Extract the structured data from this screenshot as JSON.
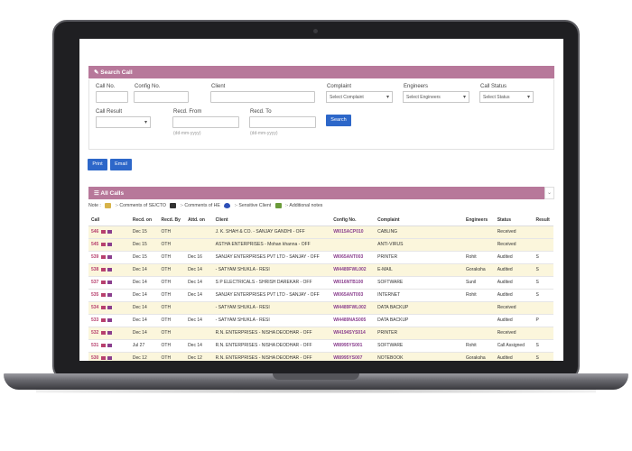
{
  "search": {
    "title": "Search Call",
    "call_no_label": "Call No.",
    "config_no_label": "Config No.",
    "client_label": "Client",
    "complaint_label": "Complaint",
    "complaint_value": "Select Complaint",
    "engineers_label": "Engineers",
    "engineers_value": "Select Engineers",
    "call_status_label": "Call Status",
    "call_status_value": "Select Status",
    "call_result_label": "Call Result",
    "recd_from_label": "Recd. From",
    "recd_to_label": "Recd. To",
    "date_hint_from": "(dd-mm-yyyy)",
    "date_hint_to": "(dd-mm-yyyy)",
    "search_button": "Search"
  },
  "actions": {
    "print": "Print",
    "email": "Email"
  },
  "all_calls": {
    "title": "All Calls",
    "note_label": "Note :",
    "note_se": ":- Comments of SE/CTO",
    "note_he": ":- Comments of HE",
    "note_sensitive": ":- Sensitive Client",
    "note_additional": ":- Additional notes",
    "columns": [
      "Call",
      "Recd. on",
      "Recd. By",
      "Attd. on",
      "Client",
      "Config No.",
      "Complaint",
      "Engineers",
      "Status",
      "Result"
    ],
    "rows": [
      {
        "call": "546",
        "recd_on": "Dec 15",
        "recd_by": "OTH",
        "attd_on": "",
        "client": "J. K. SHAH & CO. - SANJAY GANDHI - OFF",
        "config": "WI015ACP010",
        "complaint": "CABLING",
        "engineer": "",
        "status": "Received",
        "result": ""
      },
      {
        "call": "545",
        "recd_on": "Dec 15",
        "recd_by": "OTH",
        "attd_on": "",
        "client": "ASTHA ENTERPRISES - Mohan khanna - OFF",
        "config": "",
        "complaint": "ANTI-VIRUS",
        "engineer": "",
        "status": "Received",
        "result": ""
      },
      {
        "call": "539",
        "recd_on": "Dec 15",
        "recd_by": "OTH",
        "attd_on": "Dec 16",
        "client": "SANJAY ENTERPRISES PVT LTD - SANJAY - OFF",
        "config": "WI065ANT003",
        "complaint": "PRINTER",
        "engineer": "Rohit",
        "status": "Audited",
        "result": "S"
      },
      {
        "call": "538",
        "recd_on": "Dec 14",
        "recd_by": "OTH",
        "attd_on": "Dec 14",
        "client": "- SATYAM SHUKLA - RESI",
        "config": "WI4489FWL002",
        "complaint": "E-MAIL",
        "engineer": "Goraksha",
        "status": "Audited",
        "result": "S"
      },
      {
        "call": "537",
        "recd_on": "Dec 14",
        "recd_by": "OTH",
        "attd_on": "Dec 14",
        "client": "S P ELECTRICALS - SHRISH DAREKAR - OFF",
        "config": "WI016NTB100",
        "complaint": "SOFTWARE",
        "engineer": "Sunil",
        "status": "Audited",
        "result": "S"
      },
      {
        "call": "535",
        "recd_on": "Dec 14",
        "recd_by": "OTH",
        "attd_on": "Dec 14",
        "client": "SANJAY ENTERPRISES PVT LTD - SANJAY - OFF",
        "config": "WI065ANT003",
        "complaint": "INTERNET",
        "engineer": "Rohit",
        "status": "Audited",
        "result": "S"
      },
      {
        "call": "534",
        "recd_on": "Dec 14",
        "recd_by": "OTH",
        "attd_on": "",
        "client": "- SATYAM SHUKLA - RESI",
        "config": "WI4489FWL002",
        "complaint": "DATA BACKUP",
        "engineer": "",
        "status": "Received",
        "result": ""
      },
      {
        "call": "533",
        "recd_on": "Dec 14",
        "recd_by": "OTH",
        "attd_on": "Dec 14",
        "client": "- SATYAM SHUKLA - RESI",
        "config": "WI4489NAS005",
        "complaint": "DATA BACKUP",
        "engineer": "",
        "status": "Audited",
        "result": "P"
      },
      {
        "call": "532",
        "recd_on": "Dec 14",
        "recd_by": "OTH",
        "attd_on": "",
        "client": "R.N. ENTERPRISES - NISHA DEODHAR - OFF",
        "config": "WI4194SYS014",
        "complaint": "PRINTER",
        "engineer": "",
        "status": "Received",
        "result": ""
      },
      {
        "call": "531",
        "recd_on": "Jul 27",
        "recd_by": "OTH",
        "attd_on": "Dec 14",
        "client": "R.N. ENTERPRISES - NISHA DEODHAR - OFF",
        "config": "WI8995YS001",
        "complaint": "SOFTWARE",
        "engineer": "Rohit",
        "status": "Call Assigned",
        "result": "S"
      },
      {
        "call": "530",
        "recd_on": "Dec 12",
        "recd_by": "OTH",
        "attd_on": "Dec 12",
        "client": "R.N. ENTERPRISES - NISHA DEODHAR - OFF",
        "config": "WI8995YS007",
        "complaint": "NOTEBOOK",
        "engineer": "Goraksha",
        "status": "Audited",
        "result": "S"
      }
    ],
    "highlighted_rows": [
      0,
      1,
      3,
      6,
      8,
      10
    ]
  }
}
